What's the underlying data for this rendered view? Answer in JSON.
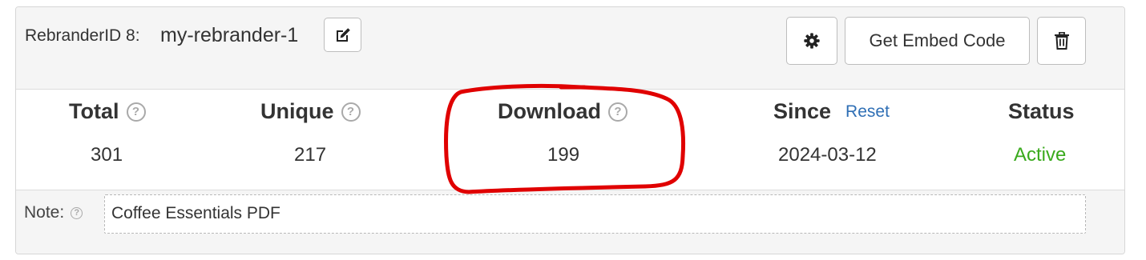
{
  "header": {
    "rebrander_label": "RebranderID 8:",
    "rebrander_name": "my-rebrander-1",
    "embed_button_label": "Get Embed Code"
  },
  "stats": [
    {
      "key": "total",
      "label": "Total",
      "value": "301",
      "has_help": true
    },
    {
      "key": "unique",
      "label": "Unique",
      "value": "217",
      "has_help": true
    },
    {
      "key": "download",
      "label": "Download",
      "value": "199",
      "has_help": true
    },
    {
      "key": "since",
      "label": "Since",
      "value": "2024-03-12",
      "link": "Reset"
    },
    {
      "key": "status",
      "label": "Status",
      "value": "Active"
    }
  ],
  "note": {
    "label": "Note:",
    "value": "Coffee Essentials PDF"
  },
  "icons": {
    "edit": "edit-icon",
    "settings": "gear-icon",
    "delete": "trash-icon",
    "help": "help-icon"
  },
  "colors": {
    "status_active": "#3aaa1d",
    "link": "#2f6fb5",
    "annotation": "#e00000"
  }
}
